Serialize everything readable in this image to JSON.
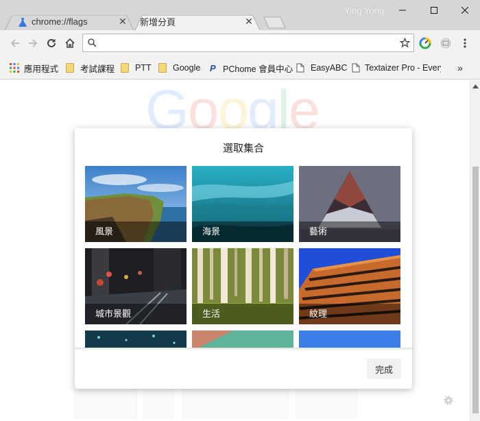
{
  "window": {
    "user_name": "Ying Yong"
  },
  "tabs": [
    {
      "title": "chrome://flags",
      "close": "✕"
    },
    {
      "title": "新增分頁",
      "close": "✕"
    }
  ],
  "toolbar": {
    "address_value": ""
  },
  "bookmarks": [
    {
      "label": "應用程式",
      "icon": "apps-grid-icon"
    },
    {
      "label": "考試課程",
      "icon": "folder-icon"
    },
    {
      "label": "PTT",
      "icon": "folder-icon"
    },
    {
      "label": "Google",
      "icon": "folder-icon"
    },
    {
      "label": "PChome 會員中心",
      "icon": "pchome-icon"
    },
    {
      "label": "EasyABC",
      "icon": "page-icon"
    },
    {
      "label": "Textaizer Pro - Every",
      "icon": "page-icon"
    }
  ],
  "bookmarks_more": "»",
  "logo": {
    "letters": [
      "G",
      "o",
      "o",
      "g",
      "l",
      "e"
    ],
    "colors": [
      "#4285f4",
      "#ea4335",
      "#fbbc05",
      "#4285f4",
      "#34a853",
      "#ea4335"
    ]
  },
  "dialog": {
    "title": "選取集合",
    "done_label": "完成",
    "collections": [
      {
        "label": "風景"
      },
      {
        "label": "海景"
      },
      {
        "label": "藝術"
      },
      {
        "label": "城市景觀"
      },
      {
        "label": "生活"
      },
      {
        "label": "紋理"
      },
      {
        "label": ""
      },
      {
        "label": ""
      },
      {
        "label": ""
      }
    ]
  }
}
